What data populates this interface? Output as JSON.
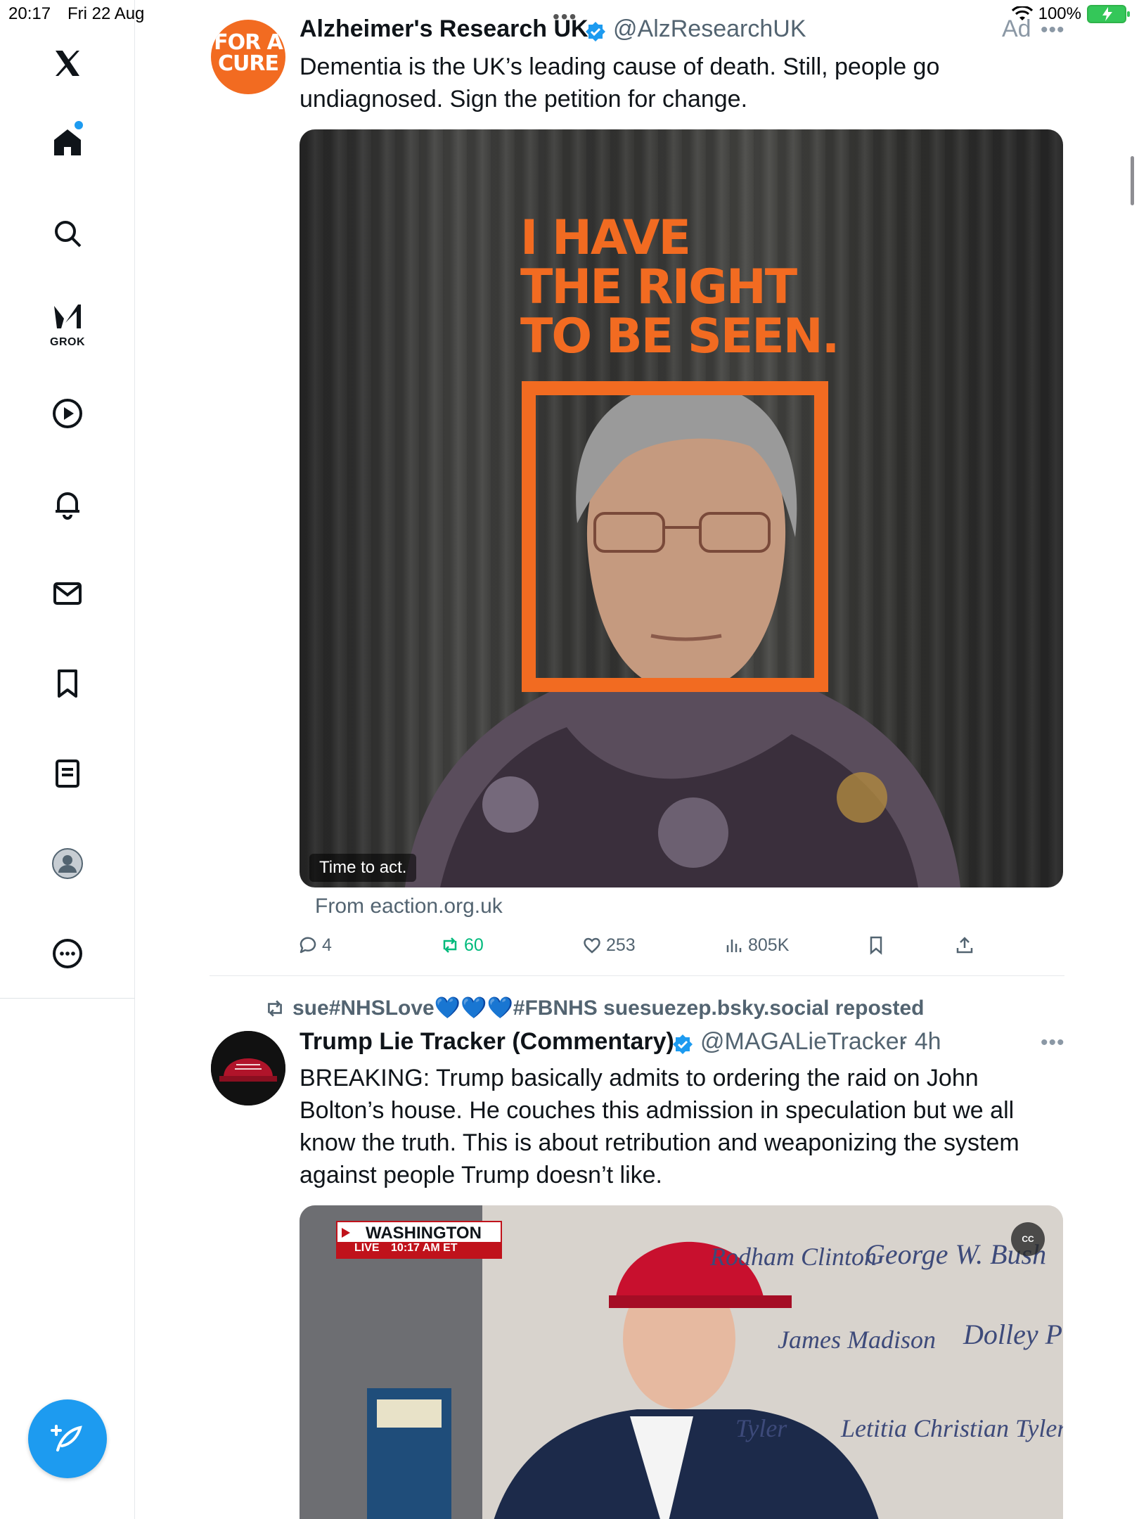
{
  "status_bar": {
    "time": "20:17",
    "date": "Fri 22 Aug",
    "battery": "100%"
  },
  "sidebar": {
    "items": [
      {
        "name": "x-logo",
        "icon": "x-logo-icon"
      },
      {
        "name": "home",
        "icon": "home-icon",
        "has_notification_dot": true
      },
      {
        "name": "explore",
        "icon": "search-icon"
      },
      {
        "name": "grok",
        "icon": "grok-icon",
        "label": "GROK"
      },
      {
        "name": "videos",
        "icon": "play-icon"
      },
      {
        "name": "notifications",
        "icon": "bell-icon"
      },
      {
        "name": "messages",
        "icon": "mail-icon"
      },
      {
        "name": "bookmarks",
        "icon": "bookmark-icon"
      },
      {
        "name": "lists",
        "icon": "list-icon"
      },
      {
        "name": "profile",
        "icon": "profile-icon"
      },
      {
        "name": "more",
        "icon": "more-icon"
      }
    ],
    "compose_icon": "compose-icon"
  },
  "tweets": [
    {
      "author": "Alzheimer's Research UK",
      "handle": "@AlzResearchUK",
      "verified": true,
      "ad_label": "Ad",
      "avatar_text": [
        "FOR A",
        "CURE"
      ],
      "text": "Dementia is the UK’s leading cause of death. Still, people go undiagnosed. Sign the petition for change.",
      "media": {
        "headline": [
          "I HAVE",
          "THE RIGHT",
          "TO BE SEEN."
        ],
        "caption": "Time to act.",
        "accent": "#f26b21"
      },
      "source": "From eaction.org.uk",
      "stats": {
        "replies": "4",
        "reposts": "60",
        "likes": "253",
        "views": "805K"
      }
    },
    {
      "repost_by": "sue#NHSLove💙💙💙#FBNHS suesuezep.bsky.social reposted",
      "author": "Trump Lie Tracker (Commentary)",
      "handle": "@MAGALieTracker",
      "time": "· 4h",
      "verified": true,
      "text": "BREAKING: Trump basically admits to ordering the raid on John Bolton’s house. He couches this admission in speculation but we all know the truth. This is about retribution and weaponizing the system against people Trump doesn’t like.",
      "media": {
        "news_location": "WASHINGTON",
        "news_live": "LIVE",
        "news_time": "10:17 AM ET",
        "cc_label": "CC",
        "wall_names": [
          "Rodham Clinton",
          "George W. Bush",
          "James Madison",
          "Dolley Pa",
          "Letitia Christian Tyler",
          "Tyler"
        ]
      }
    }
  ],
  "colors": {
    "accent": "#1d9bf0",
    "text": "#0f1419",
    "secondary": "#536471",
    "repost_green": "#00ba7c",
    "brand_orange": "#f26b21"
  }
}
